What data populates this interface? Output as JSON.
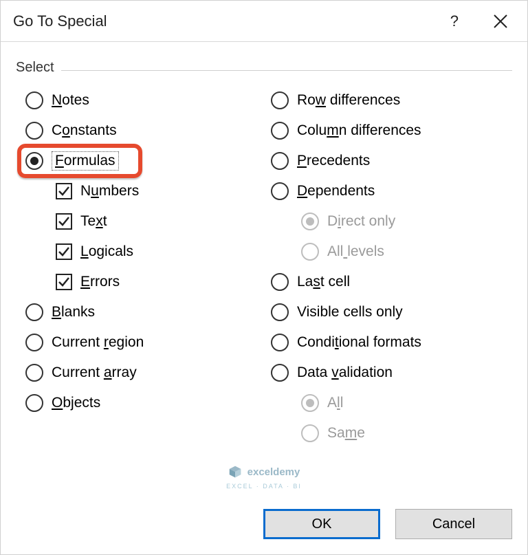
{
  "title": "Go To Special",
  "groupLabel": "Select",
  "left": {
    "notes": {
      "label": "Notes",
      "ul": 0,
      "type": "radio",
      "sel": false
    },
    "constants": {
      "label": "Constants",
      "ul": 1,
      "type": "radio",
      "sel": false
    },
    "formulas": {
      "label": "Formulas",
      "ul": 0,
      "type": "radio",
      "sel": true,
      "highlight": true
    },
    "numbers": {
      "label": "Numbers",
      "ul": 1,
      "type": "check",
      "sel": true,
      "indent": 1
    },
    "text": {
      "label": "Text",
      "ul": 2,
      "type": "check",
      "sel": true,
      "indent": 1
    },
    "logicals": {
      "label": "Logicals",
      "ul": 0,
      "type": "check",
      "sel": true,
      "indent": 1
    },
    "errors": {
      "label": "Errors",
      "ul": 0,
      "type": "check",
      "sel": true,
      "indent": 1
    },
    "blanks": {
      "label": "Blanks",
      "ul": 0,
      "type": "radio",
      "sel": false
    },
    "curreg": {
      "label": "Current region",
      "ul": 8,
      "type": "radio",
      "sel": false
    },
    "curarr": {
      "label": "Current array",
      "ul": 8,
      "type": "radio",
      "sel": false
    },
    "objects": {
      "label": "Objects",
      "ul": 0,
      "type": "radio",
      "sel": false
    }
  },
  "right": {
    "rowdiff": {
      "label": "Row differences",
      "ul": 2,
      "type": "radio",
      "sel": false
    },
    "coldiff": {
      "label": "Column differences",
      "ul": 4,
      "type": "radio",
      "sel": false
    },
    "prec": {
      "label": "Precedents",
      "ul": 0,
      "type": "radio",
      "sel": false
    },
    "dep": {
      "label": "Dependents",
      "ul": 0,
      "type": "radio",
      "sel": false
    },
    "direct": {
      "label": "Direct only",
      "ul": 1,
      "type": "radio",
      "sel": true,
      "indent": 1,
      "dis": true
    },
    "alllev": {
      "label": "All levels",
      "ul": 3,
      "type": "radio",
      "sel": false,
      "indent": 1,
      "dis": true
    },
    "lastcell": {
      "label": "Last cell",
      "ul": 2,
      "type": "radio",
      "sel": false
    },
    "visible": {
      "label": "Visible cells only",
      "ul": 18,
      "type": "radio",
      "sel": false
    },
    "condf": {
      "label": "Conditional formats",
      "ul": 5,
      "type": "radio",
      "sel": false
    },
    "datav": {
      "label": "Data validation",
      "ul": 5,
      "type": "radio",
      "sel": false
    },
    "all": {
      "label": "All",
      "ul": 1,
      "type": "radio",
      "sel": true,
      "indent": 1,
      "dis": true
    },
    "same": {
      "label": "Same",
      "ul": 2,
      "type": "radio",
      "sel": false,
      "indent": 1,
      "dis": true
    }
  },
  "buttons": {
    "ok": "OK",
    "cancel": "Cancel"
  },
  "watermark": {
    "brand": "exceldemy",
    "sub": "EXCEL · DATA · BI"
  }
}
